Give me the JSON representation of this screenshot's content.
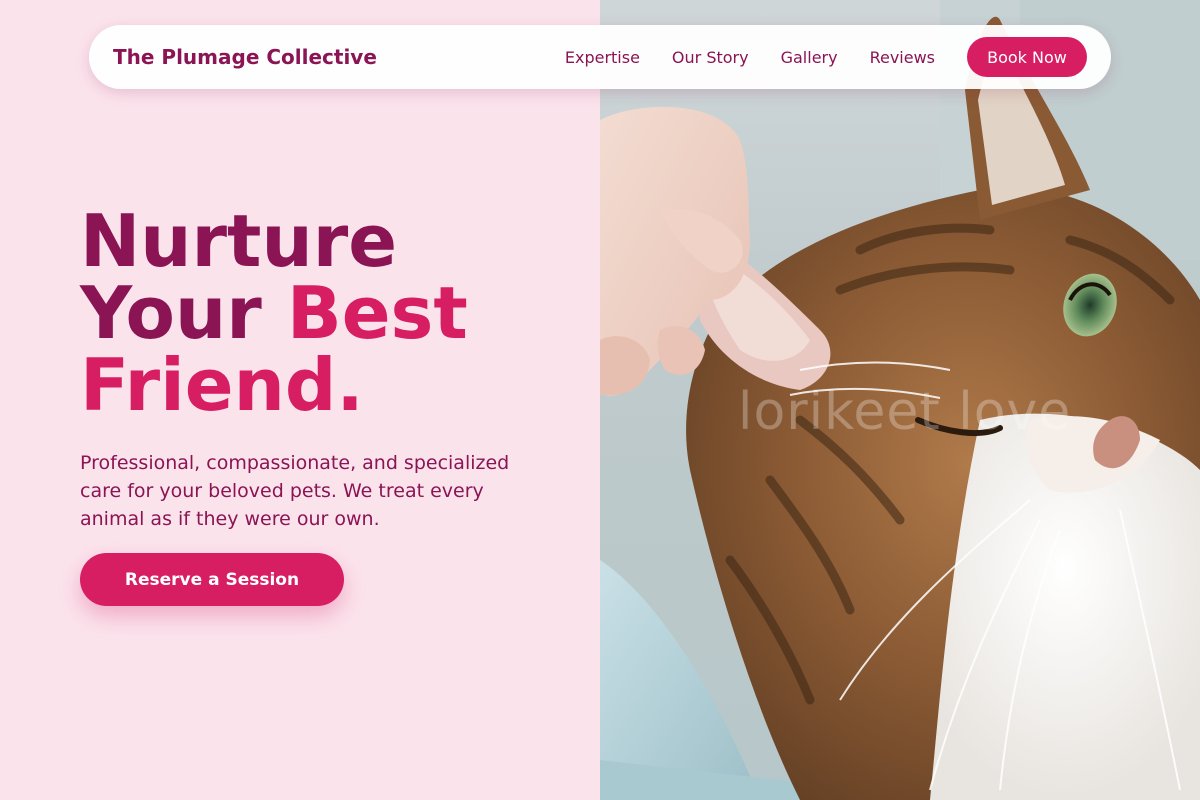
{
  "nav": {
    "brand": "The Plumage Collective",
    "links": [
      "Expertise",
      "Our Story",
      "Gallery",
      "Reviews"
    ],
    "book_label": "Book Now"
  },
  "hero": {
    "line1": "Nurture",
    "line2_a": "Your ",
    "line2_b": "Best",
    "line3": "Friend.",
    "tagline": "Professional, compassionate, and specialized care for your beloved pets. We treat every animal as if they were our own.",
    "cta_label": "Reserve a Session"
  },
  "photo": {
    "subject": "tabby cat having its ear gently held by a hand",
    "watermark": "lorikeet love"
  },
  "colors": {
    "page_background": "#fbe3ec",
    "brand_dark": "#8a1454",
    "accent": "#d81e62",
    "button_text": "#ffffff"
  }
}
